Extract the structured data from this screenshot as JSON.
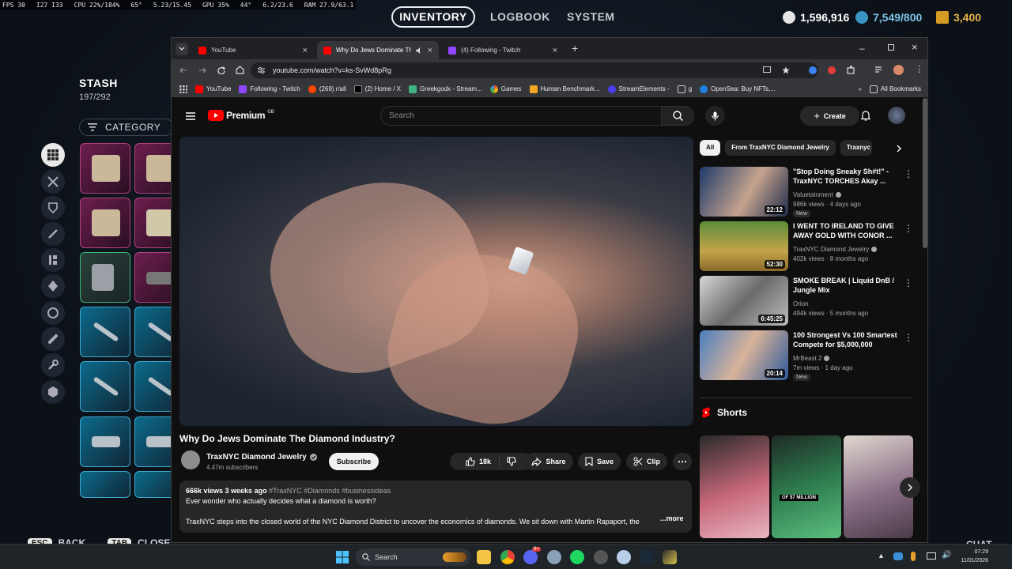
{
  "osd": {
    "fps": "FPS 30",
    "frametime": "I27 I33",
    "cpu": "CPU 22%/184%",
    "temp": "65°",
    "clock": "5.23/15.45",
    "gpu": "GPU 35%",
    "gpu_temp": "44°",
    "vram": "6.2/23.6",
    "ram": "RAM 27.9/63.1"
  },
  "game": {
    "nav_tabs": [
      "INVENTORY",
      "LOGBOOK",
      "SYSTEM"
    ],
    "currency_1": "1,596,916",
    "currency_2": "7,549/800",
    "currency_3": "3,400",
    "stash_title": "STASH",
    "stash_count": "197/292",
    "category_label": "CATEGORY",
    "esc_key": "ESC",
    "esc_label": "BACK",
    "tab_key": "TAB",
    "tab_label": "CLOSE",
    "right_hint": "CHAT"
  },
  "browser": {
    "tabs": [
      {
        "title": "YouTube"
      },
      {
        "title": "Why Do Jews Dominate The"
      },
      {
        "title": "(4) Following - Twitch"
      }
    ],
    "url": "youtube.com/watch?v=ks-SvWd8pRg",
    "bookmarks": [
      "YouTube",
      "Following - Twitch",
      "(269) r/all",
      "(2) Home / X",
      "Greekgodx - Stream...",
      "Games",
      "Human Benchmark...",
      "StreamElements -",
      "g",
      "OpenSea: Buy NFTs,...",
      "All Bookmarks"
    ]
  },
  "youtube": {
    "logo_text": "Premium",
    "logo_region": "GB",
    "search_placeholder": "Search",
    "create_label": "Create",
    "video_title": "Why Do Jews Dominate The Diamond Industry?",
    "channel_name": "TraxNYC Diamond Jewelry",
    "channel_subs": "4.47m subscribers",
    "subscribe_label": "Subscribe",
    "like_count": "18k",
    "share_label": "Share",
    "save_label": "Save",
    "clip_label": "Clip",
    "desc_meta": "666k views  3 weeks ago",
    "desc_tags": "#TraxNYC #Diamonds #businessideas",
    "desc_line1": "Ever wonder who actually decides what a diamond is worth?",
    "desc_line2": "TraxNYC steps into the closed world of the NYC Diamond District to uncover the economics of diamonds. We sit down with Martin Rapaport, the",
    "desc_more": "...more",
    "chips": [
      "All",
      "From TraxNYC Diamond Jewelry",
      "Traxnyc"
    ],
    "recommendations": [
      {
        "title": "\"Stop Doing Sneaky Sh#t!\" - TraxNYC TORCHES Akay ...",
        "channel": "Valuetainment",
        "meta": "986k views · 4 days ago",
        "duration": "22:12",
        "badge": "New",
        "thumb_color": "#2f4b7c"
      },
      {
        "title": "I WENT TO IRELAND TO GIVE AWAY GOLD WITH CONOR ...",
        "channel": "TraxNYC Diamond Jewelry",
        "meta": "402k views · 8 months ago",
        "duration": "52:30",
        "badge": "",
        "thumb_color": "#7a8a3a"
      },
      {
        "title": "SMOKE BREAK | Liquid DnB / Jungle Mix",
        "channel": "Orion",
        "meta": "494k views · 5 months ago",
        "duration": "6:45:25",
        "badge": "",
        "thumb_color": "#9aa0a6"
      },
      {
        "title": "100 Strongest Vs 100 Smartest Compete for $5,000,000",
        "channel": "MrBeast 2",
        "meta": "7m views · 1 day ago",
        "duration": "20:14",
        "badge": "New",
        "thumb_color": "#3f6fb5"
      }
    ],
    "shorts_label": "Shorts",
    "shorts": [
      {
        "color": "#c8687a"
      },
      {
        "color": "#2e7d4f",
        "caption": "OF $7 MILLION"
      },
      {
        "color": "#8a6f86"
      }
    ]
  },
  "taskbar": {
    "search_placeholder": "Search",
    "time": "07:29",
    "date": "11/01/2026",
    "badge": "9+"
  }
}
